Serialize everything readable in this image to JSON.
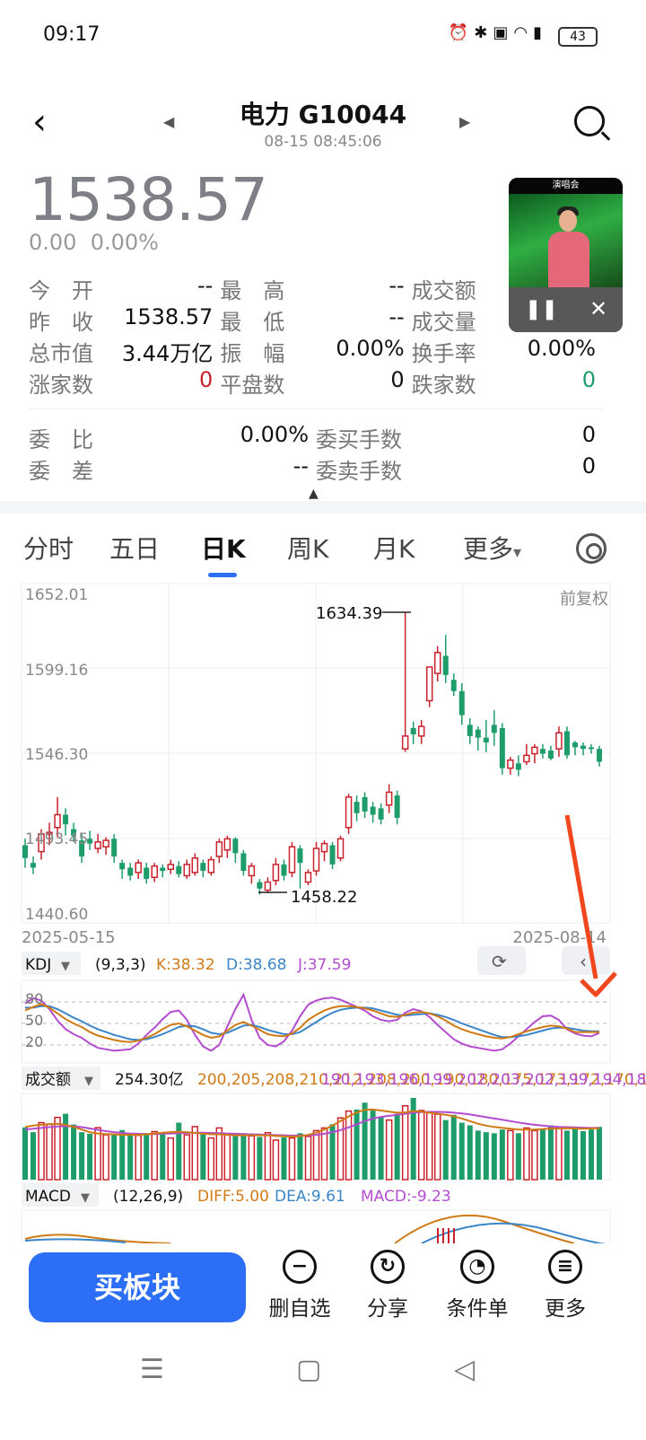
{
  "status_bar": {
    "time": "09:17",
    "battery": "43",
    "icons": [
      "alarm-icon",
      "bluetooth-icon",
      "hd-icon",
      "wifi-icon",
      "5g-signal-icon"
    ]
  },
  "header": {
    "title": "电力 G10044",
    "subtitle": "08-15 08:45:06"
  },
  "quote": {
    "price": "1538.57",
    "change": "0.00",
    "change_pct": "0.00%"
  },
  "stats": [
    [
      {
        "label": "今　开",
        "value": "--"
      },
      {
        "label": "最　高",
        "value": "--"
      },
      {
        "label": "成交额",
        "value": ""
      }
    ],
    [
      {
        "label": "昨　收",
        "value": "1538.57"
      },
      {
        "label": "最　低",
        "value": "--"
      },
      {
        "label": "成交量",
        "value": ""
      }
    ],
    [
      {
        "label": "总市值",
        "value": "3.44万亿"
      },
      {
        "label": "振　幅",
        "value": "0.00%"
      },
      {
        "label": "换手率",
        "value": "0.00%"
      }
    ],
    [
      {
        "label": "涨家数",
        "value": "0",
        "color": "red"
      },
      {
        "label": "平盘数",
        "value": "0"
      },
      {
        "label": "跌家数",
        "value": "0",
        "color": "green"
      }
    ]
  ],
  "stats2": [
    [
      {
        "label": "委　比",
        "value": "0.00%"
      },
      {
        "label": "委买手数",
        "value": "0"
      }
    ],
    [
      {
        "label": "委　差",
        "value": "--"
      },
      {
        "label": "委卖手数",
        "value": "0"
      }
    ]
  ],
  "tabs": [
    "分时",
    "五日",
    "日K",
    "周K",
    "月K",
    "更多"
  ],
  "active_tab": "日K",
  "more_caret": "▾",
  "pip": {
    "header": "演唱会"
  },
  "chart_data": {
    "type": "candlestick",
    "price_labels": [
      "1652.01",
      "1599.16",
      "1546.30",
      "1493.45",
      "1440.60"
    ],
    "ylim": [
      1440.6,
      1652.01
    ],
    "adjust_label": "前复权",
    "start_date": "2025-05-15",
    "end_date": "2025-08-14",
    "annotation_high": "1634.39",
    "annotation_low": "1458.22",
    "candles": [
      [
        1481,
        1489,
        1475,
        1493,
        "g"
      ],
      [
        1478,
        1475,
        1471,
        1482,
        "g"
      ],
      [
        1485,
        1496,
        1480,
        1499,
        "r"
      ],
      [
        1496,
        1497,
        1489,
        1503,
        "r"
      ],
      [
        1500,
        1508,
        1494,
        1519,
        "r"
      ],
      [
        1508,
        1502,
        1495,
        1512,
        "g"
      ],
      [
        1499,
        1495,
        1491,
        1503,
        "g"
      ],
      [
        1492,
        1482,
        1478,
        1496,
        "g"
      ],
      [
        1493,
        1490,
        1486,
        1498,
        "g"
      ],
      [
        1487,
        1491,
        1484,
        1496,
        "r"
      ],
      [
        1488,
        1492,
        1483,
        1494,
        "r"
      ],
      [
        1493,
        1482,
        1478,
        1496,
        "g"
      ],
      [
        1478,
        1474,
        1468,
        1480,
        "g"
      ],
      [
        1475,
        1470,
        1467,
        1478,
        "g"
      ],
      [
        1472,
        1478,
        1468,
        1480,
        "r"
      ],
      [
        1475,
        1468,
        1465,
        1478,
        "g"
      ],
      [
        1469,
        1476,
        1466,
        1478,
        "r"
      ],
      [
        1475,
        1473,
        1469,
        1477,
        "g"
      ],
      [
        1474,
        1477,
        1471,
        1480,
        "r"
      ],
      [
        1476,
        1471,
        1469,
        1479,
        "g"
      ],
      [
        1470,
        1477,
        1468,
        1480,
        "r"
      ],
      [
        1472,
        1481,
        1470,
        1484,
        "r"
      ],
      [
        1478,
        1473,
        1469,
        1480,
        "g"
      ],
      [
        1472,
        1480,
        1470,
        1482,
        "r"
      ],
      [
        1482,
        1491,
        1478,
        1493,
        "r"
      ],
      [
        1486,
        1493,
        1481,
        1495,
        "r"
      ],
      [
        1493,
        1484,
        1478,
        1494,
        "g"
      ],
      [
        1484,
        1473,
        1470,
        1486,
        "g"
      ],
      [
        1470,
        1476,
        1465,
        1478,
        "r"
      ],
      [
        1466,
        1462,
        1458.22,
        1468,
        "g"
      ],
      [
        1461,
        1466,
        1459,
        1469,
        "r"
      ],
      [
        1467,
        1477,
        1464,
        1481,
        "r"
      ],
      [
        1477,
        1470,
        1467,
        1480,
        "g"
      ],
      [
        1472,
        1488,
        1469,
        1491,
        "r"
      ],
      [
        1487,
        1478,
        1462,
        1489,
        "g"
      ],
      [
        1466,
        1472,
        1464,
        1474,
        "r"
      ],
      [
        1473,
        1487,
        1470,
        1491,
        "r"
      ],
      [
        1485,
        1490,
        1479,
        1492,
        "r"
      ],
      [
        1489,
        1477,
        1474,
        1491,
        "g"
      ],
      [
        1481,
        1493,
        1479,
        1495,
        "r"
      ],
      [
        1500,
        1519,
        1496,
        1521,
        "r"
      ],
      [
        1516,
        1509,
        1504,
        1520,
        "g"
      ],
      [
        1510,
        1519,
        1506,
        1522,
        "g"
      ],
      [
        1513,
        1508,
        1503,
        1516,
        "g"
      ],
      [
        1512,
        1505,
        1502,
        1515,
        "g"
      ],
      [
        1514,
        1522,
        1509,
        1527,
        "r"
      ],
      [
        1520,
        1506,
        1502,
        1523,
        "g"
      ],
      [
        1557,
        1549,
        1547,
        1634.39,
        "r"
      ],
      [
        1562,
        1558,
        1552,
        1566,
        "g"
      ],
      [
        1557,
        1563,
        1552,
        1567,
        "r"
      ],
      [
        1579,
        1600,
        1575,
        1600,
        "r"
      ],
      [
        1596,
        1609,
        1591,
        1613,
        "r"
      ],
      [
        1607,
        1595,
        1590,
        1620,
        "g"
      ],
      [
        1592,
        1585,
        1582,
        1596,
        "g"
      ],
      [
        1585,
        1570,
        1564,
        1590,
        "g"
      ],
      [
        1564,
        1557,
        1552,
        1568,
        "g"
      ],
      [
        1561,
        1556,
        1548,
        1563,
        "g"
      ],
      [
        1556,
        1553,
        1547,
        1567,
        "g"
      ],
      [
        1564,
        1559,
        1551,
        1573,
        "g"
      ],
      [
        1562,
        1537,
        1533,
        1565,
        "g"
      ],
      [
        1537,
        1542,
        1533,
        1544,
        "r"
      ],
      [
        1540,
        1536,
        1532,
        1545,
        "g"
      ],
      [
        1541,
        1545,
        1539,
        1552,
        "r"
      ],
      [
        1546,
        1550,
        1540,
        1552,
        "r"
      ],
      [
        1546,
        1549,
        1543,
        1552,
        "g"
      ],
      [
        1548,
        1543,
        1542,
        1551,
        "g"
      ],
      [
        1549,
        1559,
        1544,
        1563,
        "r"
      ],
      [
        1560,
        1545,
        1543,
        1563,
        "g"
      ],
      [
        1550,
        1553,
        1545,
        1554,
        "g"
      ],
      [
        1551,
        1549,
        1545,
        1553,
        "g"
      ],
      [
        1550,
        1550,
        1546,
        1552,
        "g"
      ],
      [
        1549,
        1541,
        1538,
        1551,
        "g"
      ]
    ],
    "kdj": {
      "label": "KDJ",
      "params": "(9,3,3)",
      "k": "K:38.32",
      "d": "D:38.68",
      "j": "J:37.59",
      "levels": [
        "80",
        "50",
        "20"
      ],
      "K": [
        68,
        73,
        77,
        72,
        64,
        56,
        50,
        45,
        38,
        33,
        30,
        27,
        25,
        24,
        26,
        30,
        35,
        42,
        48,
        50,
        46,
        40,
        34,
        30,
        32,
        40,
        48,
        52,
        47,
        41,
        35,
        33,
        32,
        36,
        44,
        55,
        62,
        68,
        72,
        74,
        74,
        73,
        71,
        68,
        64,
        60,
        59,
        62,
        65,
        66,
        64,
        60,
        54,
        47,
        42,
        38,
        35,
        32,
        30,
        29,
        31,
        35,
        39,
        42,
        45,
        47,
        46,
        43,
        38,
        38,
        38,
        38
      ],
      "D": [
        72,
        72,
        74,
        74,
        70,
        64,
        58,
        53,
        47,
        42,
        38,
        34,
        31,
        28,
        27,
        28,
        31,
        35,
        40,
        45,
        47,
        46,
        42,
        37,
        35,
        37,
        42,
        47,
        48,
        45,
        41,
        38,
        35,
        35,
        38,
        45,
        52,
        59,
        65,
        69,
        71,
        72,
        72,
        71,
        68,
        65,
        62,
        61,
        62,
        63,
        64,
        62,
        59,
        55,
        50,
        46,
        42,
        38,
        34,
        31,
        31,
        32,
        34,
        37,
        40,
        43,
        44,
        44,
        42,
        40,
        39,
        39
      ],
      "J": [
        78,
        85,
        82,
        70,
        54,
        42,
        35,
        30,
        22,
        16,
        14,
        12,
        13,
        14,
        22,
        34,
        44,
        56,
        66,
        68,
        55,
        34,
        18,
        12,
        20,
        46,
        70,
        90,
        55,
        30,
        20,
        18,
        25,
        40,
        60,
        76,
        82,
        85,
        86,
        83,
        78,
        73,
        68,
        60,
        55,
        53,
        55,
        65,
        70,
        67,
        59,
        48,
        38,
        28,
        22,
        18,
        16,
        14,
        12,
        14,
        22,
        32,
        42,
        52,
        60,
        61,
        55,
        42,
        36,
        33,
        32,
        37
      ]
    },
    "volume": {
      "label": "成交额",
      "value": "254.30亿",
      "ma5": [
        200,
        205,
        208,
        210,
        212,
        208,
        200,
        190,
        180,
        175,
        173,
        172,
        170,
        170,
        170,
        172,
        175,
        178,
        180,
        182,
        180,
        177,
        174,
        172,
        172,
        170,
        168,
        168,
        168,
        168,
        168,
        166,
        164,
        163,
        165,
        170,
        178,
        190,
        205,
        222,
        240,
        255,
        265,
        266,
        262,
        258,
        254,
        255,
        260,
        258,
        254,
        250,
        246,
        240,
        232,
        222,
        212,
        205,
        200,
        196,
        193,
        190,
        190,
        190,
        192,
        193,
        194,
        195,
        194,
        193,
        194,
        195
      ],
      "ma10": [
        190,
        193,
        196,
        199,
        202,
        203,
        202,
        199,
        194,
        189,
        184,
        180,
        177,
        175,
        174,
        173,
        173,
        174,
        175,
        176,
        177,
        178,
        178,
        177,
        176,
        175,
        174,
        173,
        172,
        171,
        170,
        169,
        168,
        167,
        167,
        168,
        170,
        174,
        180,
        188,
        198,
        210,
        222,
        232,
        238,
        242,
        246,
        250,
        254,
        256,
        257,
        257,
        256,
        254,
        251,
        247,
        242,
        237,
        232,
        227,
        222,
        217,
        212,
        208,
        205,
        202,
        200,
        199,
        198,
        197,
        196,
        196
      ],
      "vals": [
        198,
        180,
        216,
        211,
        236,
        250,
        209,
        180,
        174,
        197,
        170,
        174,
        188,
        170,
        168,
        176,
        182,
        178,
        158,
        216,
        170,
        201,
        172,
        158,
        196,
        172,
        168,
        176,
        166,
        162,
        178,
        150,
        160,
        158,
        176,
        164,
        186,
        196,
        210,
        234,
        260,
        266,
        292,
        262,
        240,
        226,
        250,
        280,
        310,
        262,
        254,
        248,
        226,
        246,
        216,
        206,
        186,
        180,
        176,
        190,
        186,
        176,
        196,
        186,
        190,
        206,
        198,
        186,
        196,
        184,
        190,
        200
      ]
    },
    "macd": {
      "label": "MACD",
      "params": "(12,26,9)",
      "diff": "DIFF:5.00",
      "dea": "DEA:9.61",
      "macd": "MACD:-9.23"
    }
  },
  "bottom_bar": {
    "buy": "买板块",
    "actions": [
      {
        "label": "删自选",
        "icon": "−"
      },
      {
        "label": "分享",
        "icon": "↻"
      },
      {
        "label": "条件单",
        "icon": "◔"
      },
      {
        "label": "更多",
        "icon": "≡"
      }
    ]
  }
}
